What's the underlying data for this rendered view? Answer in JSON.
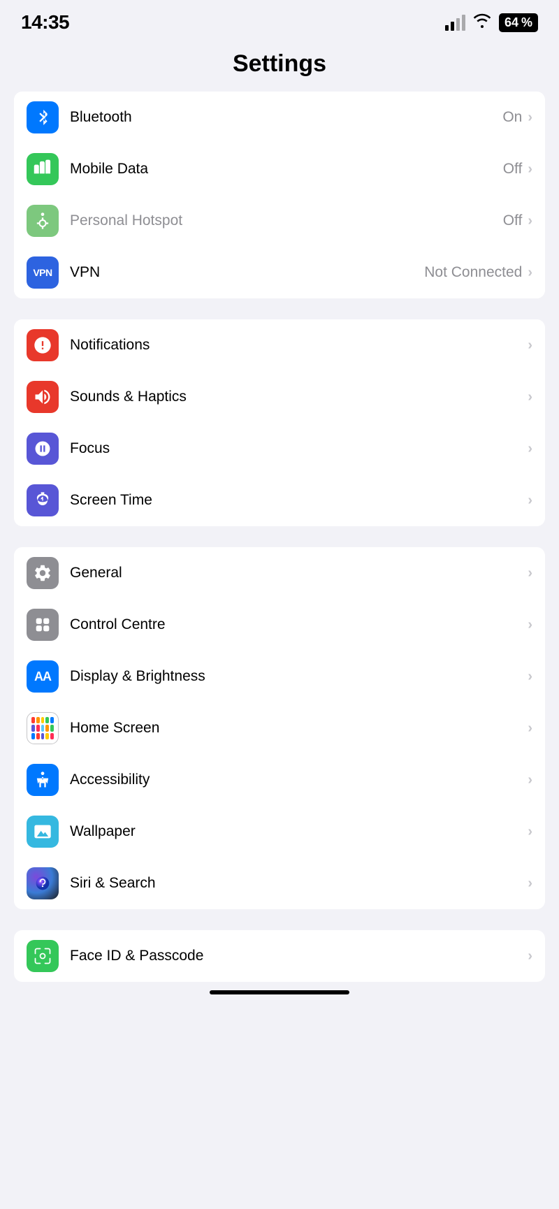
{
  "statusBar": {
    "time": "14:35",
    "battery": "64"
  },
  "pageTitle": "Settings",
  "groups": [
    {
      "id": "connectivity",
      "items": [
        {
          "id": "bluetooth",
          "label": "Bluetooth",
          "value": "On",
          "iconColor": "icon-bluetooth",
          "iconType": "bluetooth"
        },
        {
          "id": "mobile-data",
          "label": "Mobile Data",
          "value": "Off",
          "iconColor": "icon-mobile",
          "iconType": "wifi"
        },
        {
          "id": "hotspot",
          "label": "Personal Hotspot",
          "value": "Off",
          "iconColor": "icon-hotspot",
          "iconType": "hotspot",
          "disabled": true
        },
        {
          "id": "vpn",
          "label": "VPN",
          "value": "Not Connected",
          "iconColor": "icon-vpn",
          "iconType": "vpn"
        }
      ]
    },
    {
      "id": "notifications",
      "items": [
        {
          "id": "notifications",
          "label": "Notifications",
          "value": "",
          "iconColor": "icon-notifications",
          "iconType": "bell"
        },
        {
          "id": "sounds",
          "label": "Sounds & Haptics",
          "value": "",
          "iconColor": "icon-sounds",
          "iconType": "speaker"
        },
        {
          "id": "focus",
          "label": "Focus",
          "value": "",
          "iconColor": "icon-focus",
          "iconType": "moon"
        },
        {
          "id": "screen-time",
          "label": "Screen Time",
          "value": "",
          "iconColor": "icon-screentime",
          "iconType": "hourglass"
        }
      ]
    },
    {
      "id": "display",
      "items": [
        {
          "id": "general",
          "label": "General",
          "value": "",
          "iconColor": "icon-general",
          "iconType": "gear"
        },
        {
          "id": "control-centre",
          "label": "Control Centre",
          "value": "",
          "iconColor": "icon-controlcentre",
          "iconType": "toggles"
        },
        {
          "id": "display-brightness",
          "label": "Display & Brightness",
          "value": "",
          "iconColor": "icon-display",
          "iconType": "aa"
        },
        {
          "id": "home-screen",
          "label": "Home Screen",
          "value": "",
          "iconColor": "icon-homescreen",
          "iconType": "homescreen"
        },
        {
          "id": "accessibility",
          "label": "Accessibility",
          "value": "",
          "iconColor": "icon-accessibility",
          "iconType": "accessibility"
        },
        {
          "id": "wallpaper",
          "label": "Wallpaper",
          "value": "",
          "iconColor": "icon-wallpaper",
          "iconType": "wallpaper"
        },
        {
          "id": "siri-search",
          "label": "Siri & Search",
          "value": "",
          "iconColor": "icon-siri",
          "iconType": "siri"
        }
      ]
    }
  ],
  "partialRow": {
    "label": "Face ID & Passcode",
    "iconColor": "icon-faceid",
    "iconType": "faceid"
  }
}
